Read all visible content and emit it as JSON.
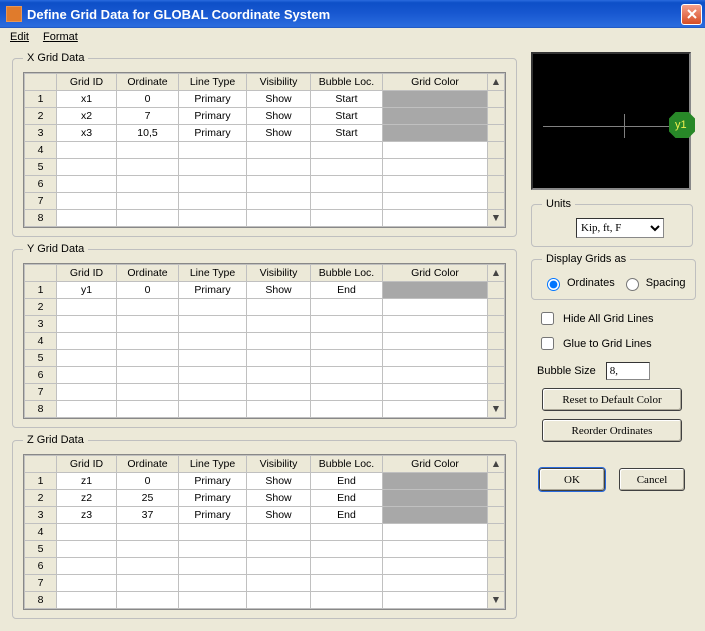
{
  "window": {
    "title": "Define Grid Data for GLOBAL Coordinate System"
  },
  "menu": {
    "edit": "Edit",
    "format": "Format"
  },
  "xGrid": {
    "legend": "X Grid Data",
    "headers": {
      "gridId": "Grid ID",
      "ordinate": "Ordinate",
      "lineType": "Line Type",
      "visibility": "Visibility",
      "bubbleLoc": "Bubble Loc.",
      "gridColor": "Grid Color"
    },
    "rows": [
      {
        "n": "1",
        "id": "x1",
        "ord": "0",
        "lt": "Primary",
        "vis": "Show",
        "bub": "Start",
        "filled": true
      },
      {
        "n": "2",
        "id": "x2",
        "ord": "7",
        "lt": "Primary",
        "vis": "Show",
        "bub": "Start",
        "filled": true
      },
      {
        "n": "3",
        "id": "x3",
        "ord": "10,5",
        "lt": "Primary",
        "vis": "Show",
        "bub": "Start",
        "filled": true
      },
      {
        "n": "4",
        "id": "",
        "ord": "",
        "lt": "",
        "vis": "",
        "bub": "",
        "filled": false
      },
      {
        "n": "5",
        "id": "",
        "ord": "",
        "lt": "",
        "vis": "",
        "bub": "",
        "filled": false
      },
      {
        "n": "6",
        "id": "",
        "ord": "",
        "lt": "",
        "vis": "",
        "bub": "",
        "filled": false
      },
      {
        "n": "7",
        "id": "",
        "ord": "",
        "lt": "",
        "vis": "",
        "bub": "",
        "filled": false
      },
      {
        "n": "8",
        "id": "",
        "ord": "",
        "lt": "",
        "vis": "",
        "bub": "",
        "filled": false
      }
    ]
  },
  "yGrid": {
    "legend": "Y Grid Data",
    "rows": [
      {
        "n": "1",
        "id": "y1",
        "ord": "0",
        "lt": "Primary",
        "vis": "Show",
        "bub": "End",
        "filled": true
      },
      {
        "n": "2",
        "id": "",
        "ord": "",
        "lt": "",
        "vis": "",
        "bub": "",
        "filled": false
      },
      {
        "n": "3",
        "id": "",
        "ord": "",
        "lt": "",
        "vis": "",
        "bub": "",
        "filled": false
      },
      {
        "n": "4",
        "id": "",
        "ord": "",
        "lt": "",
        "vis": "",
        "bub": "",
        "filled": false
      },
      {
        "n": "5",
        "id": "",
        "ord": "",
        "lt": "",
        "vis": "",
        "bub": "",
        "filled": false
      },
      {
        "n": "6",
        "id": "",
        "ord": "",
        "lt": "",
        "vis": "",
        "bub": "",
        "filled": false
      },
      {
        "n": "7",
        "id": "",
        "ord": "",
        "lt": "",
        "vis": "",
        "bub": "",
        "filled": false
      },
      {
        "n": "8",
        "id": "",
        "ord": "",
        "lt": "",
        "vis": "",
        "bub": "",
        "filled": false
      }
    ]
  },
  "zGrid": {
    "legend": "Z Grid Data",
    "rows": [
      {
        "n": "1",
        "id": "z1",
        "ord": "0",
        "lt": "Primary",
        "vis": "Show",
        "bub": "End",
        "filled": true
      },
      {
        "n": "2",
        "id": "z2",
        "ord": "25",
        "lt": "Primary",
        "vis": "Show",
        "bub": "End",
        "filled": true
      },
      {
        "n": "3",
        "id": "z3",
        "ord": "37",
        "lt": "Primary",
        "vis": "Show",
        "bub": "End",
        "filled": true
      },
      {
        "n": "4",
        "id": "",
        "ord": "",
        "lt": "",
        "vis": "",
        "bub": "",
        "filled": false
      },
      {
        "n": "5",
        "id": "",
        "ord": "",
        "lt": "",
        "vis": "",
        "bub": "",
        "filled": false
      },
      {
        "n": "6",
        "id": "",
        "ord": "",
        "lt": "",
        "vis": "",
        "bub": "",
        "filled": false
      },
      {
        "n": "7",
        "id": "",
        "ord": "",
        "lt": "",
        "vis": "",
        "bub": "",
        "filled": false
      },
      {
        "n": "8",
        "id": "",
        "ord": "",
        "lt": "",
        "vis": "",
        "bub": "",
        "filled": false
      }
    ]
  },
  "preview": {
    "bubble": "y1"
  },
  "units": {
    "legend": "Units",
    "value": "Kip, ft, F"
  },
  "displayAs": {
    "legend": "Display Grids as",
    "ordinates": "Ordinates",
    "spacing": "Spacing"
  },
  "options": {
    "hideAll": "Hide All Grid Lines",
    "glue": "Glue to Grid Lines",
    "bubbleSizeLabel": "Bubble Size",
    "bubbleSizeValue": "8,"
  },
  "buttons": {
    "reset": "Reset to Default Color",
    "reorder": "Reorder Ordinates",
    "ok": "OK",
    "cancel": "Cancel"
  }
}
